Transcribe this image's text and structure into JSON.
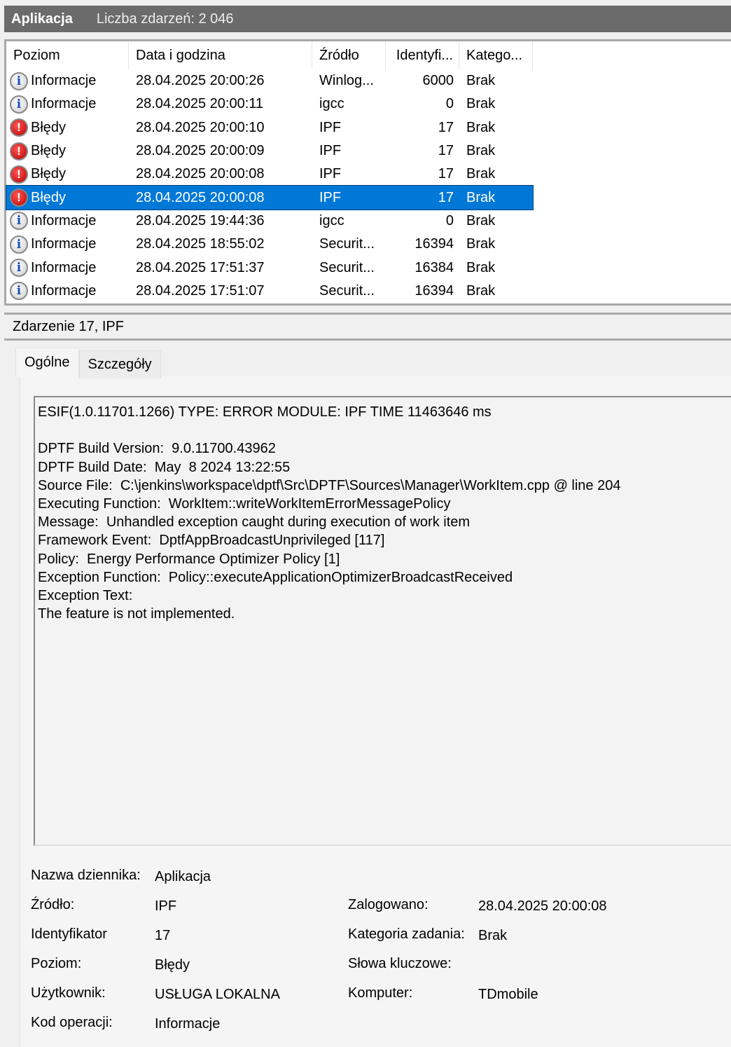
{
  "title": {
    "log": "Aplikacja",
    "count": "Liczba zdarzeń: 2 046"
  },
  "columns": [
    "Poziom",
    "Data i godzina",
    "Źródło",
    "Identyfi...",
    "Katego..."
  ],
  "rows": [
    {
      "icon": "info",
      "level": "Informacje",
      "date": "28.04.2025 20:00:26",
      "source": "Winlog...",
      "id": "6000",
      "cat": "Brak"
    },
    {
      "icon": "info",
      "level": "Informacje",
      "date": "28.04.2025 20:00:11",
      "source": "igcc",
      "id": "0",
      "cat": "Brak"
    },
    {
      "icon": "err",
      "level": "Błędy",
      "date": "28.04.2025 20:00:10",
      "source": "IPF",
      "id": "17",
      "cat": "Brak"
    },
    {
      "icon": "err",
      "level": "Błędy",
      "date": "28.04.2025 20:00:09",
      "source": "IPF",
      "id": "17",
      "cat": "Brak"
    },
    {
      "icon": "err",
      "level": "Błędy",
      "date": "28.04.2025 20:00:08",
      "source": "IPF",
      "id": "17",
      "cat": "Brak"
    },
    {
      "icon": "err",
      "level": "Błędy",
      "date": "28.04.2025 20:00:08",
      "source": "IPF",
      "id": "17",
      "cat": "Brak",
      "selected": true
    },
    {
      "icon": "info",
      "level": "Informacje",
      "date": "28.04.2025 19:44:36",
      "source": "igcc",
      "id": "0",
      "cat": "Brak"
    },
    {
      "icon": "info",
      "level": "Informacje",
      "date": "28.04.2025 18:55:02",
      "source": "Securit...",
      "id": "16394",
      "cat": "Brak"
    },
    {
      "icon": "info",
      "level": "Informacje",
      "date": "28.04.2025 17:51:37",
      "source": "Securit...",
      "id": "16384",
      "cat": "Brak"
    },
    {
      "icon": "info",
      "level": "Informacje",
      "date": "28.04.2025 17:51:07",
      "source": "Securit...",
      "id": "16394",
      "cat": "Brak"
    }
  ],
  "detail": {
    "header": "Zdarzenie 17, IPF",
    "tabs": [
      "Ogólne",
      "Szczegóły"
    ],
    "message": "ESIF(1.0.11701.1266) TYPE: ERROR MODULE: IPF TIME 11463646 ms\n\nDPTF Build Version:  9.0.11700.43962\nDPTF Build Date:  May  8 2024 13:22:55\nSource File:  C:\\jenkins\\workspace\\dptf\\Src\\DPTF\\Sources\\Manager\\WorkItem.cpp @ line 204\nExecuting Function:  WorkItem::writeWorkItemErrorMessagePolicy\nMessage:  Unhandled exception caught during execution of work item\nFramework Event:  DptfAppBroadcastUnprivileged [117]\nPolicy:  Energy Performance Optimizer Policy [1]\nException Function:  Policy::executeApplicationOptimizerBroadcastReceived\nException Text:\nThe feature is not implemented.",
    "props": {
      "log_label": "Nazwa dziennika:",
      "log": "Aplikacja",
      "source_label": "Źródło:",
      "source": "IPF",
      "logged_label": "Zalogowano:",
      "logged": "28.04.2025 20:00:08",
      "id_label": "Identyfikator",
      "id": "17",
      "task_label": "Kategoria zadania:",
      "task": "Brak",
      "level_label": "Poziom:",
      "level": "Błędy",
      "keywords_label": "Słowa kluczowe:",
      "user_label": "Użytkownik:",
      "user": "USŁUGA LOKALNA",
      "computer_label": "Komputer:",
      "computer": "TDmobile",
      "opcode_label": "Kod operacji:",
      "opcode": "Informacje"
    }
  }
}
